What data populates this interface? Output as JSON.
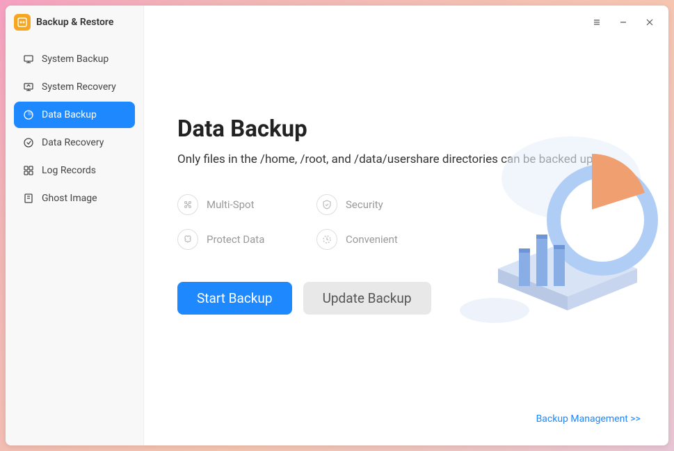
{
  "app": {
    "title": "Backup & Restore"
  },
  "sidebar": {
    "items": [
      {
        "label": "System Backup",
        "active": false
      },
      {
        "label": "System Recovery",
        "active": false
      },
      {
        "label": "Data Backup",
        "active": true
      },
      {
        "label": "Data Recovery",
        "active": false
      },
      {
        "label": "Log Records",
        "active": false
      },
      {
        "label": "Ghost Image",
        "active": false
      }
    ]
  },
  "main": {
    "title": "Data Backup",
    "description": "Only files in the /home, /root, and /data/usershare directories can be backed up",
    "features": [
      {
        "label": "Multi-Spot"
      },
      {
        "label": "Security"
      },
      {
        "label": "Protect Data"
      },
      {
        "label": "Convenient"
      }
    ],
    "buttons": {
      "primary": "Start Backup",
      "secondary": "Update Backup"
    },
    "footer_link": "Backup Management >>"
  }
}
